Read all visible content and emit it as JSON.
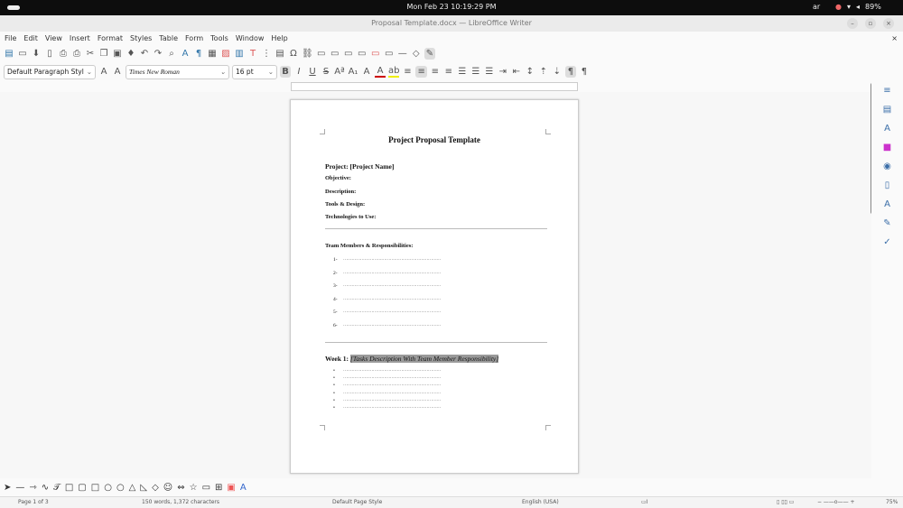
{
  "system": {
    "clock": "Mon Feb 23  10:19:29 PM",
    "lang": "ar",
    "battery": "89%"
  },
  "window": {
    "title": "Proposal Template.docx — LibreOffice Writer"
  },
  "menu": [
    "File",
    "Edit",
    "View",
    "Insert",
    "Format",
    "Styles",
    "Table",
    "Form",
    "Tools",
    "Window",
    "Help"
  ],
  "toolbar1": [
    "new-icon",
    "open-icon",
    "save-icon",
    "export-pdf-icon",
    "print-icon",
    "print-preview-icon",
    "cut-icon",
    "copy-icon",
    "paste-icon",
    "clone-formatting-icon",
    "undo-icon",
    "redo-icon",
    "find-replace-icon",
    "spelling-icon",
    "formatting-marks-icon",
    "table-icon",
    "image-icon",
    "chart-icon",
    "textbox-icon",
    "page-break-icon",
    "field-icon",
    "special-character-icon",
    "hyperlink-icon",
    "footnote-icon",
    "endnote-icon",
    "bookmark-icon",
    "cross-reference-icon",
    "comment-icon",
    "track-changes-icon",
    "line-icon",
    "shapes-icon",
    "draw-icon"
  ],
  "toolbar2": {
    "paragraph_style": "Default Paragraph Styl",
    "font_name": "Times New Roman",
    "font_size": "16 pt"
  },
  "document": {
    "title": "Project Proposal Template",
    "project": "Project: [Project Name]",
    "fields": [
      "Objective:",
      "Description:",
      "Tools & Design:",
      "Technologies to Use:"
    ],
    "team_heading": "Team Members & Responsibilities:",
    "team_numbers": [
      "1-",
      "2-",
      "3-",
      "4-",
      "5-",
      "6-"
    ],
    "dots": "……………………………………………………………",
    "week_label": "Week 1: ",
    "week_placeholder": "[Tasks Description With Team Member Responsibility]",
    "bullet_count": 6
  },
  "status": {
    "page": "Page 1 of 3",
    "words": "150 words, 1,372 characters",
    "page_style": "Default Page Style",
    "language": "English (USA)",
    "zoom": "75%"
  }
}
